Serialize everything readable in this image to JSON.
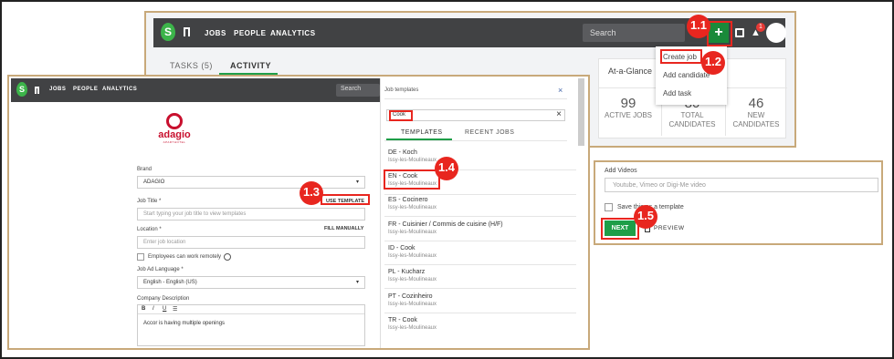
{
  "panel_main": {
    "nav": {
      "logo": "S",
      "jobs": "JOBS",
      "people": "PEOPLE",
      "analytics": "ANALYTICS",
      "search_placeholder": "Search",
      "plus": "+",
      "notif_count": "1"
    },
    "tabs": {
      "tasks": "TASKS (5)",
      "activity": "ACTIVITY"
    },
    "menu": {
      "create_job": "Create job",
      "add_candidate": "Add candidate",
      "add_task": "Add task"
    },
    "glance": {
      "title": "At-a-Glance",
      "active_num": "99",
      "active_label": "ACTIVE JOBS",
      "total_num": "80",
      "total_label1": "TOTAL",
      "total_label2": "CANDIDATES",
      "new_num": "46",
      "new_label1": "NEW",
      "new_label2": "CANDIDATES"
    }
  },
  "markers": {
    "m11": "1.1",
    "m12": "1.2",
    "m13": "1.3",
    "m14": "1.4",
    "m15": "1.5"
  },
  "panel_form": {
    "nav": {
      "logo": "S",
      "jobs": "JOBS",
      "people": "PEOPLE",
      "analytics": "ANALYTICS",
      "search": "Search"
    },
    "brand_logo": "adagio",
    "brand_sub": "APARTHOTEL",
    "brand_label": "Brand",
    "brand_value": "ADAGIO",
    "job_title_label": "Job Title *",
    "use_template": "USE TEMPLATE",
    "job_title_placeholder": "Start typing your job title to view templates",
    "location_label": "Location *",
    "fill_manually": "FILL MANUALLY",
    "location_placeholder": "Enter job location",
    "remote_label": "Employees can work remotely",
    "lang_label": "Job Ad Language *",
    "lang_value": "English - English (US)",
    "company_desc_label": "Company Description",
    "editor_bold": "B",
    "editor_italic": "I",
    "editor_underline": "U",
    "editor_list": "☰",
    "company_desc_text": "Accor is having multiple openings"
  },
  "templates": {
    "header": "Job templates",
    "search_value": "Cook",
    "tab_templates": "TEMPLATES",
    "tab_recent": "RECENT JOBS",
    "items": [
      {
        "title": "DE - Koch",
        "loc": "Issy-les-Moulineaux"
      },
      {
        "title": "EN - Cook",
        "loc": "Issy-les-Moulineaux"
      },
      {
        "title": "ES - Cocinero",
        "loc": "Issy-les-Moulineaux"
      },
      {
        "title": "FR - Cuisinier / Commis de cuisine (H/F)",
        "loc": "Issy-les-Moulineaux"
      },
      {
        "title": "ID - Cook",
        "loc": "Issy-les-Moulineaux"
      },
      {
        "title": "PL - Kucharz",
        "loc": "Issy-les-Moulineaux"
      },
      {
        "title": "PT - Cozinheiro",
        "loc": "Issy-les-Moulineaux"
      },
      {
        "title": "TR - Cook",
        "loc": "Issy-les-Moulineaux"
      }
    ]
  },
  "panel_videos": {
    "label": "Add Videos",
    "placeholder": "Youtube, Vimeo or Digi-Me video",
    "save_template": "Save this as a template",
    "next": "NEXT",
    "preview": "PREVIEW"
  },
  "colors": {
    "accent_green": "#1e9e48",
    "marker_red": "#e8261f",
    "frame": "#c8a97a",
    "topbar": "#414244"
  }
}
